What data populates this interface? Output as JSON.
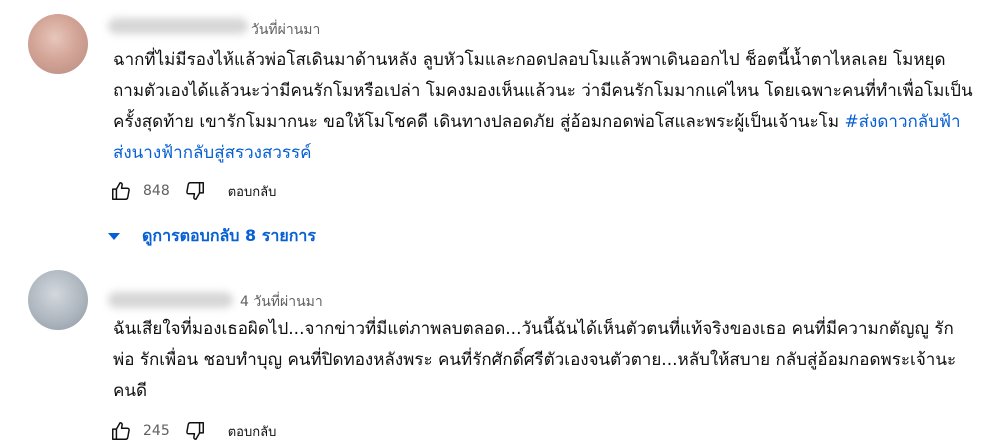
{
  "comments": [
    {
      "time": "วันที่ผ่านมา",
      "text": "ฉากที่ไม่มีรองไห้แล้วพ่อโสเดินมาด้านหลัง ลูบหัวโมและกอดปลอบโมแล้วพาเดินออกไป ช็อตนี้น้ำตาไหลเลย โมหยุดถามตัวเองได้แล้วนะว่ามีคนรักโมหรือเปล่า โมคงมองเห็นแล้วนะ ว่ามีคนรักโมมากแค่ไหน โดยเฉพาะคนที่ทำเพื่อโมเป็นครั้งสุดท้าย เขารักโมมากนะ ขอให้โมโชคดี เดินทางปลอดภัย สู่อ้อมกอดพ่อโสและพระผู้เป็นเจ้านะโม ",
      "hashtag": "#ส่งดาวกลับฟ้าส่งนางฟ้ากลับสู่สรวงสวรรค์",
      "likes": "848",
      "reply_label": "ตอบกลับ",
      "view_replies": "ดูการตอบกลับ 8 รายการ"
    },
    {
      "time": "4 วันที่ผ่านมา",
      "text": "ฉันเสียใจที่มองเธอผิดไป...จากข่าวที่มีแต่ภาพลบตลอด...วันนี้ฉันได้เห็นตัวตนที่แท้จริงของเธอ คนที่มีความกตัญญู รักพ่อ รักเพื่อน ชอบทำบุญ คนที่ปิดทองหลังพระ  คนที่รักศักดิ์ศรีตัวเองจนตัวตาย...หลับให้สบาย กลับสู่อ้อมกอดพระเจ้านะคนดี",
      "likes": "245",
      "reply_label": "ตอบกลับ"
    }
  ]
}
